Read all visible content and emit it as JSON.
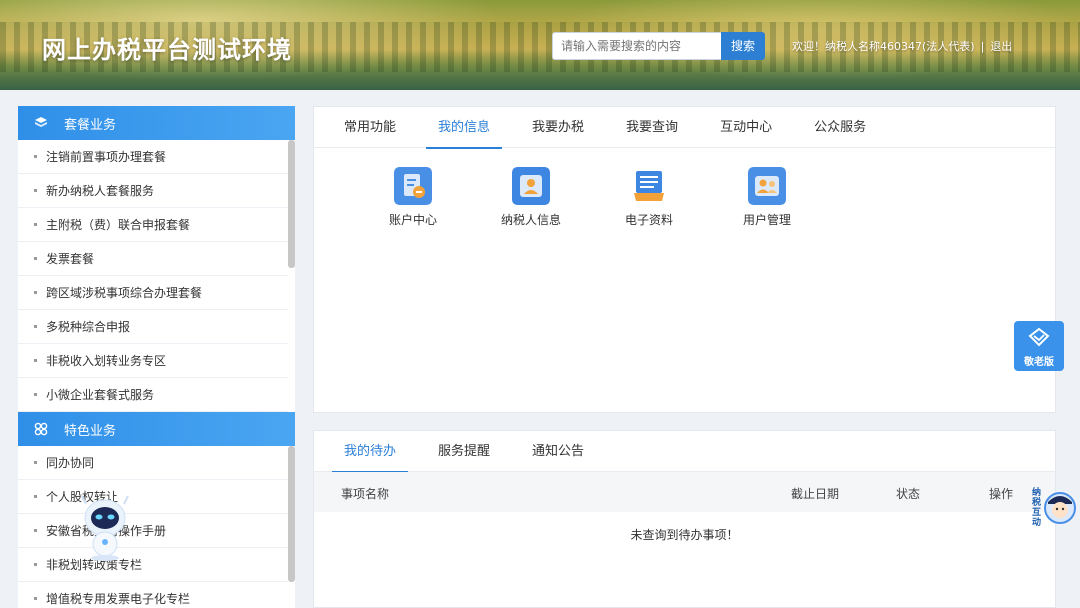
{
  "header": {
    "site_title": "网上办税平台测试环境",
    "search_placeholder": "请输入需要搜索的内容",
    "search_button": "搜索",
    "welcome": "欢迎！纳税人名称460347(法人代表)",
    "separator": "|",
    "logout": "退出"
  },
  "sidebar": {
    "sections": [
      {
        "title": "套餐业务",
        "icon": "cube-icon",
        "items": [
          "注销前置事项办理套餐",
          "新办纳税人套餐服务",
          "主附税（费）联合申报套餐",
          "发票套餐",
          "跨区域涉税事项综合办理套餐",
          "多税种综合申报",
          "非税收入划转业务专区",
          "小微企业套餐式服务"
        ]
      },
      {
        "title": "特色业务",
        "icon": "clover-icon",
        "items": [
          "同办协同",
          "个人股权转让",
          "安徽省税务局操作手册",
          "非税划转政策专栏",
          "增值税专用发票电子化专栏"
        ]
      }
    ]
  },
  "main": {
    "tabs": [
      "常用功能",
      "我的信息",
      "我要办税",
      "我要查询",
      "互动中心",
      "公众服务"
    ],
    "active_tab": 1,
    "apps": [
      {
        "label": "账户中心",
        "icon": "account-doc-icon",
        "color": "#4a8fe6"
      },
      {
        "label": "纳税人信息",
        "icon": "taxpayer-card-icon",
        "color": "#3d86e2"
      },
      {
        "label": "电子资料",
        "icon": "e-document-icon",
        "color": "#f3a23a"
      },
      {
        "label": "用户管理",
        "icon": "user-manage-icon",
        "color": "#4a8fe6"
      }
    ]
  },
  "todo": {
    "tabs": [
      "我的待办",
      "服务提醒",
      "通知公告"
    ],
    "active_tab": 0,
    "columns": [
      "事项名称",
      "截止日期",
      "状态",
      "操作"
    ],
    "empty_text": "未查询到待办事项！"
  },
  "floating": {
    "elder_mode": "敬老版",
    "assistant_text": "纳税互动"
  },
  "colors": {
    "accent": "#2a7fd6",
    "sidebar_header": "#3a98ec"
  }
}
